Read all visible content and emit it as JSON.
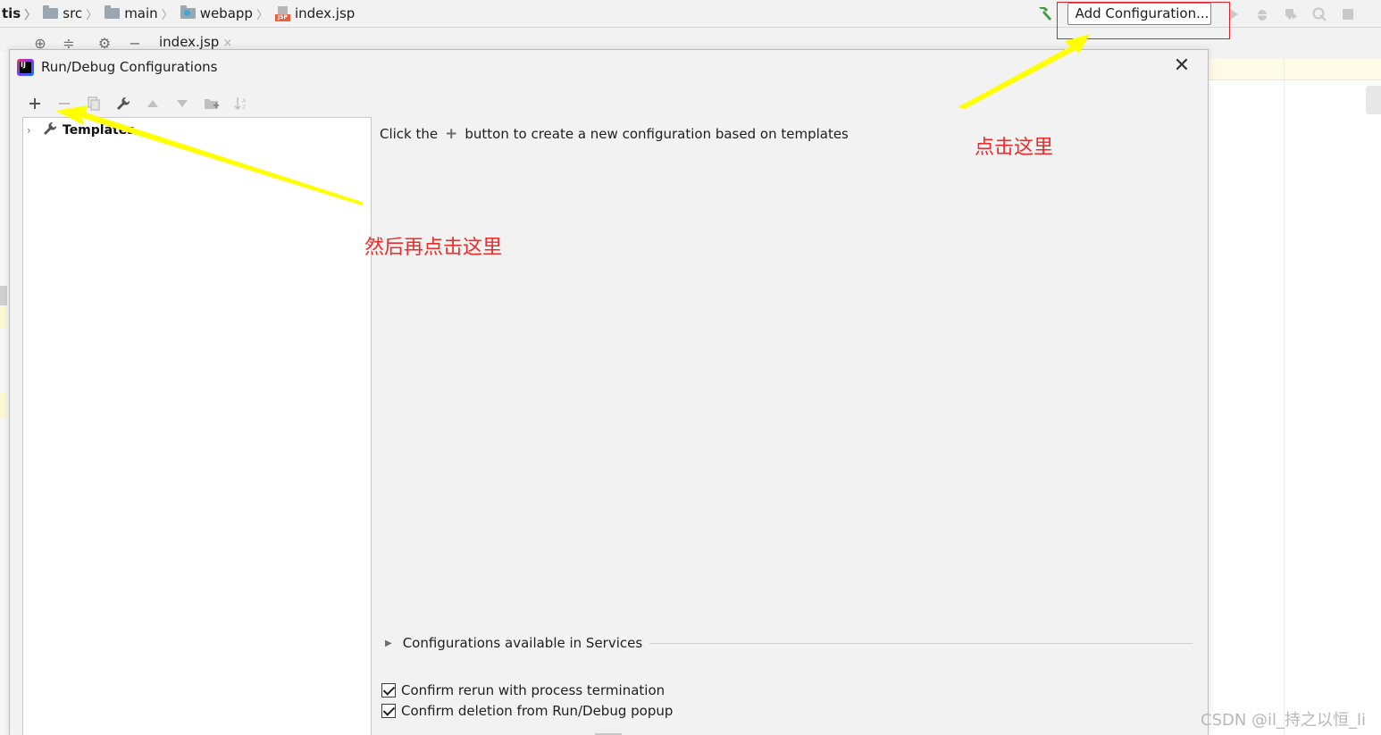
{
  "breadcrumb": {
    "items": [
      {
        "label": "tis",
        "icon": "none"
      },
      {
        "label": "src",
        "icon": "folder-icon"
      },
      {
        "label": "main",
        "icon": "folder-icon"
      },
      {
        "label": "webapp",
        "icon": "web-folder-icon"
      },
      {
        "label": "index.jsp",
        "icon": "jsp-file-icon"
      }
    ]
  },
  "toolbar": {
    "add_configuration_label": "Add Configuration...",
    "icons": [
      "hammer-icon",
      "run-icon",
      "debug-icon",
      "coverage-icon",
      "profile-icon",
      "stop-icon"
    ]
  },
  "editor": {
    "tab_label": "index.jsp",
    "tab_close": "×"
  },
  "dialog": {
    "title": "Run/Debug Configurations",
    "close_symbol": "✕",
    "toolbar_icons": [
      "add-icon",
      "remove-icon",
      "copy-icon",
      "wrench-icon",
      "move-up-icon",
      "move-down-icon",
      "folder-add-icon",
      "sort-icon"
    ],
    "tree": {
      "root_label": "Templates"
    },
    "hint": {
      "before": "Click the",
      "after": "button to create a new configuration based on templates"
    },
    "services_label": "Configurations available in Services",
    "checkboxes": [
      {
        "label": "Confirm rerun with process termination",
        "checked": true
      },
      {
        "label": "Confirm deletion from Run/Debug popup",
        "checked": true
      }
    ]
  },
  "annotations": {
    "click_here": "点击这里",
    "then_click_here": "然后再点击这里",
    "arrow_color": "#ffff00",
    "text_color": "#ee2a2a"
  },
  "watermark": "CSDN @il_持之以恒_li"
}
